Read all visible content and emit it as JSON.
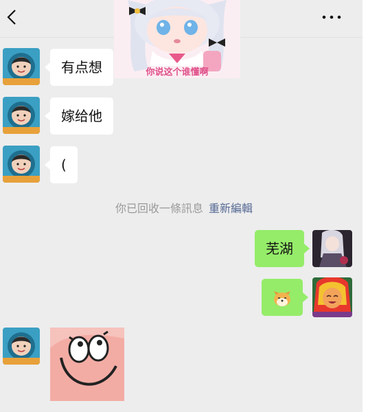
{
  "header": {
    "back_icon": "chevron-left-icon",
    "more_icon": "more-dots-icon"
  },
  "sticker_top": {
    "caption": "你说这个谁懂啊"
  },
  "messages": [
    {
      "side": "in",
      "text": "有点想"
    },
    {
      "side": "in",
      "text": "嫁给他"
    },
    {
      "side": "in",
      "text": "("
    },
    {
      "side": "out",
      "text": "芜湖"
    },
    {
      "side": "out",
      "emoji": "shiba-dog-emoji"
    },
    {
      "side": "in",
      "sticker": "patrick-star-face-sticker"
    }
  ],
  "system_notice": {
    "text": "你已回收一條訊息",
    "action": "重新編輯"
  },
  "colors": {
    "background": "#ededed",
    "bubble_in": "#ffffff",
    "bubble_out": "#95ec69",
    "link": "#576b95"
  }
}
